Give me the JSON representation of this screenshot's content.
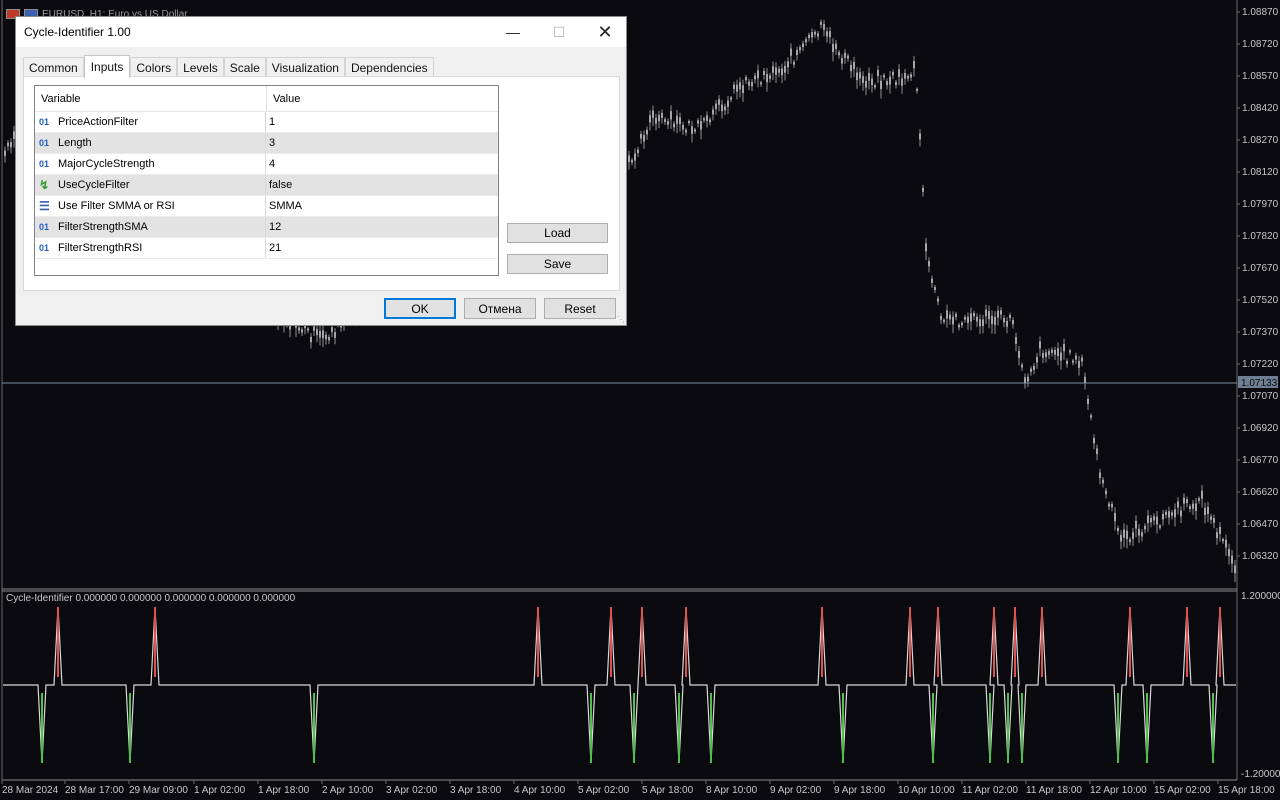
{
  "chart": {
    "header": "EURUSD, H1:  Euro vs US Dollar",
    "price_axis": [
      "1.08870",
      "1.08720",
      "1.08570",
      "1.08420",
      "1.08270",
      "1.08120",
      "1.07970",
      "1.07820",
      "1.07670",
      "1.07520",
      "1.07370",
      "1.07220",
      "1.07070",
      "1.06920",
      "1.06770",
      "1.06620",
      "1.06470",
      "1.06320"
    ],
    "current_price": "1.07133",
    "indicator_label": "Cycle-Identifier 0.000000 0.000000 0.000000 0.000000 0.000000",
    "indicator_axis": {
      "top": "1.200000",
      "bottom": "-1.200000"
    },
    "time_axis": [
      "28 Mar 2024",
      "28 Mar 17:00",
      "29 Mar 09:00",
      "1 Apr 02:00",
      "1 Apr 18:00",
      "2 Apr 10:00",
      "3 Apr 02:00",
      "3 Apr 18:00",
      "4 Apr 10:00",
      "5 Apr 02:00",
      "5 Apr 18:00",
      "8 Apr 10:00",
      "9 Apr 02:00",
      "9 Apr 18:00",
      "10 Apr 10:00",
      "11 Apr 02:00",
      "11 Apr 18:00",
      "12 Apr 10:00",
      "15 Apr 02:00",
      "15 Apr 18:00"
    ],
    "colors": {
      "background": "#0b0b0f",
      "candles": "#9a9a9a",
      "peak": "#e05050",
      "trough": "#4fc04f",
      "line": "#d8d8d8"
    }
  },
  "dialog": {
    "title": "Cycle-Identifier 1.00",
    "tabs": [
      "Common",
      "Inputs",
      "Colors",
      "Levels",
      "Scale",
      "Visualization",
      "Dependencies"
    ],
    "active_tab": "Inputs",
    "table": {
      "col_variable": "Variable",
      "col_value": "Value",
      "rows": [
        {
          "icon": "01",
          "name": "PriceActionFilter",
          "value": "1"
        },
        {
          "icon": "01",
          "name": "Length",
          "value": "3"
        },
        {
          "icon": "01",
          "name": "MajorCycleStrength",
          "value": "4"
        },
        {
          "icon": "bool-icon",
          "name": "UseCycleFilter",
          "value": "false"
        },
        {
          "icon": "enum-icon",
          "name": "Use Filter SMMA or RSI",
          "value": "SMMA"
        },
        {
          "icon": "01",
          "name": "FilterStrengthSMA",
          "value": "12"
        },
        {
          "icon": "01",
          "name": "FilterStrengthRSI",
          "value": "21"
        }
      ]
    },
    "load": "Load",
    "save": "Save",
    "ok": "OK",
    "cancel": "Отмена",
    "reset": "Reset"
  }
}
